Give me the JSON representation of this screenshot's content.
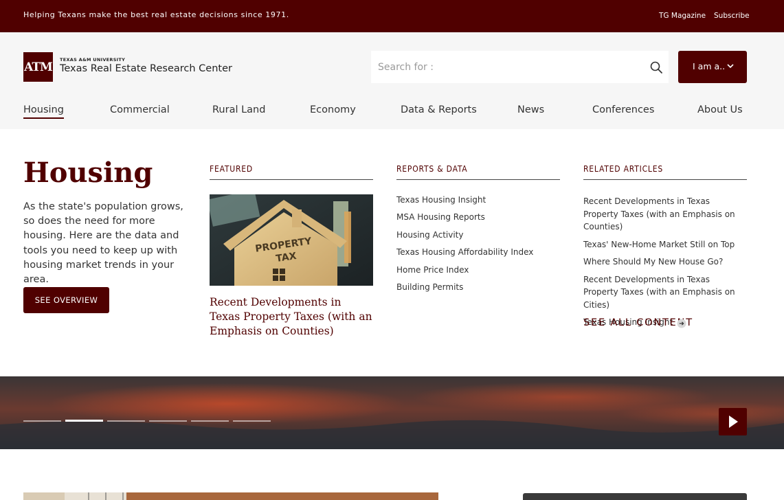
{
  "topbar": {
    "tagline": "Helping Texans make the best real estate decisions since 1971.",
    "links": [
      "TG Magazine",
      "Subscribe"
    ]
  },
  "header": {
    "logo_mark": "ATM",
    "university": "TEXAS A&M UNIVERSITY",
    "org_name": "Texas Real Estate Research Center",
    "search_placeholder": "Search for :",
    "search_value": "",
    "iam_label": "I am a..",
    "icons": [
      "search-icon",
      "chevron-down-icon"
    ]
  },
  "nav": {
    "items": [
      "Housing",
      "Commercial",
      "Rural Land",
      "Economy",
      "Data & Reports",
      "News",
      "Conferences",
      "About Us"
    ],
    "active": "Housing"
  },
  "mega_menu": {
    "title": "Housing",
    "description": "As the state's population grows, so does the need for more housing. Here are the data and tools you need to keep up with housing market trends in your area.",
    "overview_button": "SEE OVERVIEW",
    "featured": {
      "heading": "FEATURED",
      "image_text": [
        "PROPERTY",
        "TAX"
      ],
      "title": "Recent Developments in Texas Property Taxes (with an Emphasis on Counties)"
    },
    "reports": {
      "heading": "REPORTS & DATA",
      "links": [
        "Texas Housing Insight",
        "MSA Housing Reports",
        "Housing Activity",
        "Texas Housing Affordability Index",
        "Home Price Index",
        "Building Permits"
      ]
    },
    "related": {
      "heading": "RELATED ARTICLES",
      "links": [
        "Recent Developments in Texas Property Taxes (with an Emphasis on Counties)",
        "Texas' New-Home Market Still on Top",
        "Where Should My New House Go?",
        "Recent Developments in Texas Property Taxes (with an Emphasis on Cities)",
        "Texas Housing Insight"
      ],
      "see_all": "SEE ALL CONTENT"
    }
  },
  "hero": {
    "slide_count": 6,
    "active_slide": 2,
    "play_icon": "play-icon"
  },
  "colors": {
    "maroon": "#500000",
    "text": "#333333",
    "nav_bg": "#f6f6f6"
  }
}
